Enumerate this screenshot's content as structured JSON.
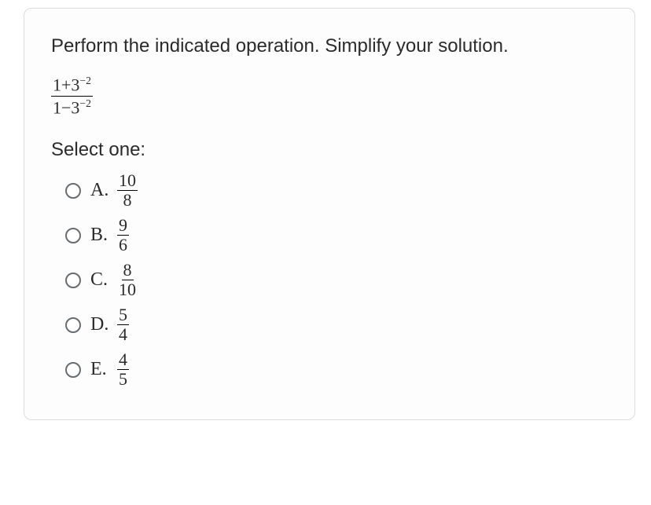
{
  "question": {
    "prompt": "Perform the indicated operation. Simplify your solution.",
    "expression": {
      "numerator_parts": [
        "1+3",
        "−2"
      ],
      "denominator_parts": [
        "1−3",
        "−2"
      ]
    },
    "select_label": "Select one:"
  },
  "options": [
    {
      "letter": "A.",
      "numer": "10",
      "denom": "8"
    },
    {
      "letter": "B.",
      "numer": "9",
      "denom": "6"
    },
    {
      "letter": "C.",
      "numer": "8",
      "denom": "10"
    },
    {
      "letter": "D.",
      "numer": "5",
      "denom": "4"
    },
    {
      "letter": "E.",
      "numer": "4",
      "denom": "5"
    }
  ]
}
